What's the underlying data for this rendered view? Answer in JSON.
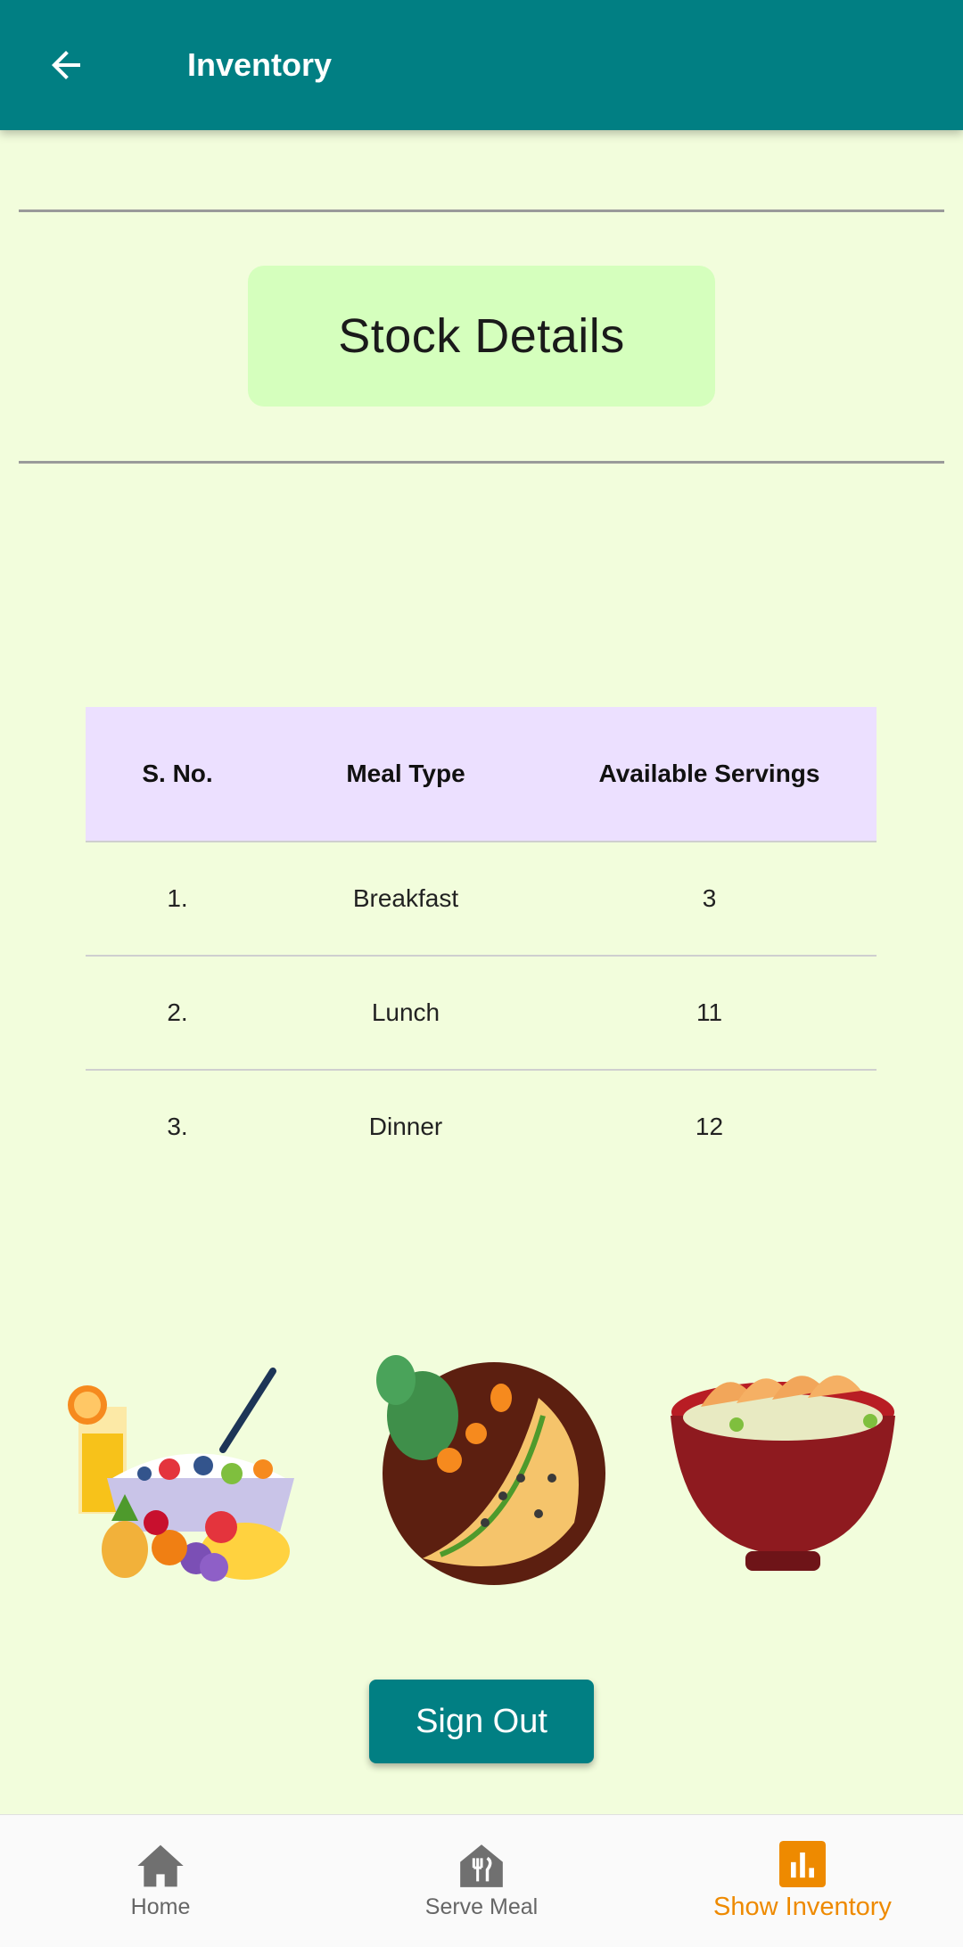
{
  "appbar": {
    "title": "Inventory",
    "back_icon": "arrow-back-icon"
  },
  "section": {
    "title": "Stock Details"
  },
  "table": {
    "headers": [
      "S. No.",
      "Meal Type",
      "Available Servings"
    ],
    "rows": [
      {
        "sno": "1.",
        "meal": "Breakfast",
        "servings": "3"
      },
      {
        "sno": "2.",
        "meal": "Lunch",
        "servings": "11"
      },
      {
        "sno": "3.",
        "meal": "Dinner",
        "servings": "12"
      }
    ]
  },
  "images": [
    "breakfast-illustration",
    "lunch-illustration",
    "dinner-illustration"
  ],
  "signout": {
    "label": "Sign Out"
  },
  "bottom_nav": {
    "items": [
      {
        "label": "Home",
        "icon": "home-icon"
      },
      {
        "label": "Serve Meal",
        "icon": "serve-meal-icon"
      },
      {
        "label": "Show Inventory",
        "icon": "inventory-chart-icon",
        "active": true
      }
    ]
  },
  "colors": {
    "primary": "#017f83",
    "background": "#f2fddc",
    "accent": "#ee8a00",
    "header_row": "#ece0ff",
    "stock_box": "#d5ffbd"
  }
}
